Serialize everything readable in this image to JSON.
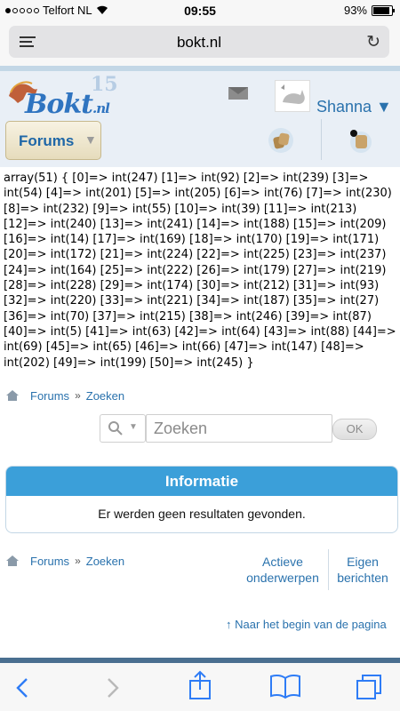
{
  "statusbar": {
    "carrier": "Telfort NL",
    "time": "09:55",
    "battery": "93%"
  },
  "browser": {
    "domain": "bokt.nl"
  },
  "header": {
    "logo_word": "Bokt",
    "logo_suffix": ".nl",
    "logo_badge": "15",
    "username": "Shanna ▼",
    "forums_label": "Forums",
    "forums_caret": "▼"
  },
  "debug_dump": "array(51) { [0]=> int(247) [1]=> int(92) [2]=> int(239) [3]=> int(54) [4]=> int(201) [5]=> int(205) [6]=> int(76) [7]=> int(230) [8]=> int(232) [9]=> int(55) [10]=> int(39) [11]=> int(213) [12]=> int(240) [13]=> int(241) [14]=> int(188) [15]=> int(209) [16]=> int(14) [17]=> int(169) [18]=> int(170) [19]=> int(171) [20]=> int(172) [21]=> int(224) [22]=> int(225) [23]=> int(237) [24]=> int(164) [25]=> int(222) [26]=> int(179) [27]=> int(219) [28]=> int(228) [29]=> int(174) [30]=> int(212) [31]=> int(93) [32]=> int(220) [33]=> int(221) [34]=> int(187) [35]=> int(27) [36]=> int(70) [37]=> int(215) [38]=> int(246) [39]=> int(87) [40]=> int(5) [41]=> int(63) [42]=> int(64) [43]=> int(88) [44]=> int(69) [45]=> int(65) [46]=> int(66) [47]=> int(147) [48]=> int(202) [49]=> int(199) [50]=> int(245) }",
  "breadcrumb": {
    "forums": "Forums",
    "separator": "»",
    "current": "Zoeken"
  },
  "search": {
    "placeholder": "Zoeken",
    "ok_label": "OK",
    "caret": "▼"
  },
  "info": {
    "title": "Informatie",
    "message": "Er werden geen resultaten gevonden."
  },
  "footer_links": {
    "active_line1": "Actieve",
    "active_line2": "onderwerpen",
    "own_line1": "Eigen",
    "own_line2": "berichten"
  },
  "back_to_top": "↑ Naar het begin van de pagina",
  "colors": {
    "accent": "#2a72ad",
    "info_header": "#3b9fd9",
    "header_bg": "#e9eff6"
  }
}
